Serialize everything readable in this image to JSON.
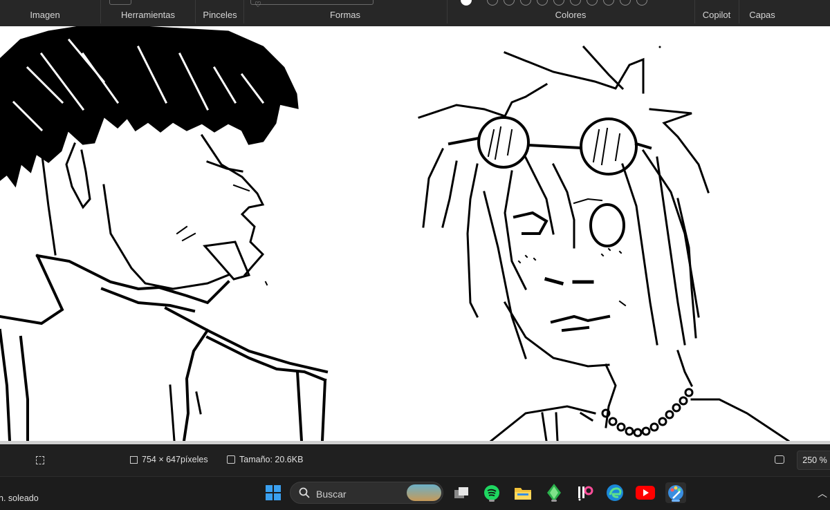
{
  "ribbon": {
    "groups": [
      {
        "label": "Imagen"
      },
      {
        "label": "Herramientas"
      },
      {
        "label": "Pinceles"
      },
      {
        "label": "Formas"
      },
      {
        "label": "Colores"
      },
      {
        "label": "Copilot"
      },
      {
        "label": "Capas"
      }
    ]
  },
  "status": {
    "dimensions": "754 × 647píxeles",
    "size": "Tamaño: 20.6KB",
    "zoom": "250 %"
  },
  "taskbar": {
    "weather": "n. soleado",
    "search_placeholder": "Buscar",
    "apps": [
      "start-icon",
      "search-icon",
      "task-view-icon",
      "spotify-icon",
      "file-explorer-icon",
      "sims-icon",
      "ibis-paint-icon",
      "edge-icon",
      "youtube-icon",
      "paint-icon"
    ]
  },
  "colors": {
    "ribbon_bg": "#272727",
    "canvas_bg": "#ffffff",
    "ink": "#000000",
    "statusbar_bg": "#202020",
    "taskbar_bg": "#1c1c1c"
  }
}
